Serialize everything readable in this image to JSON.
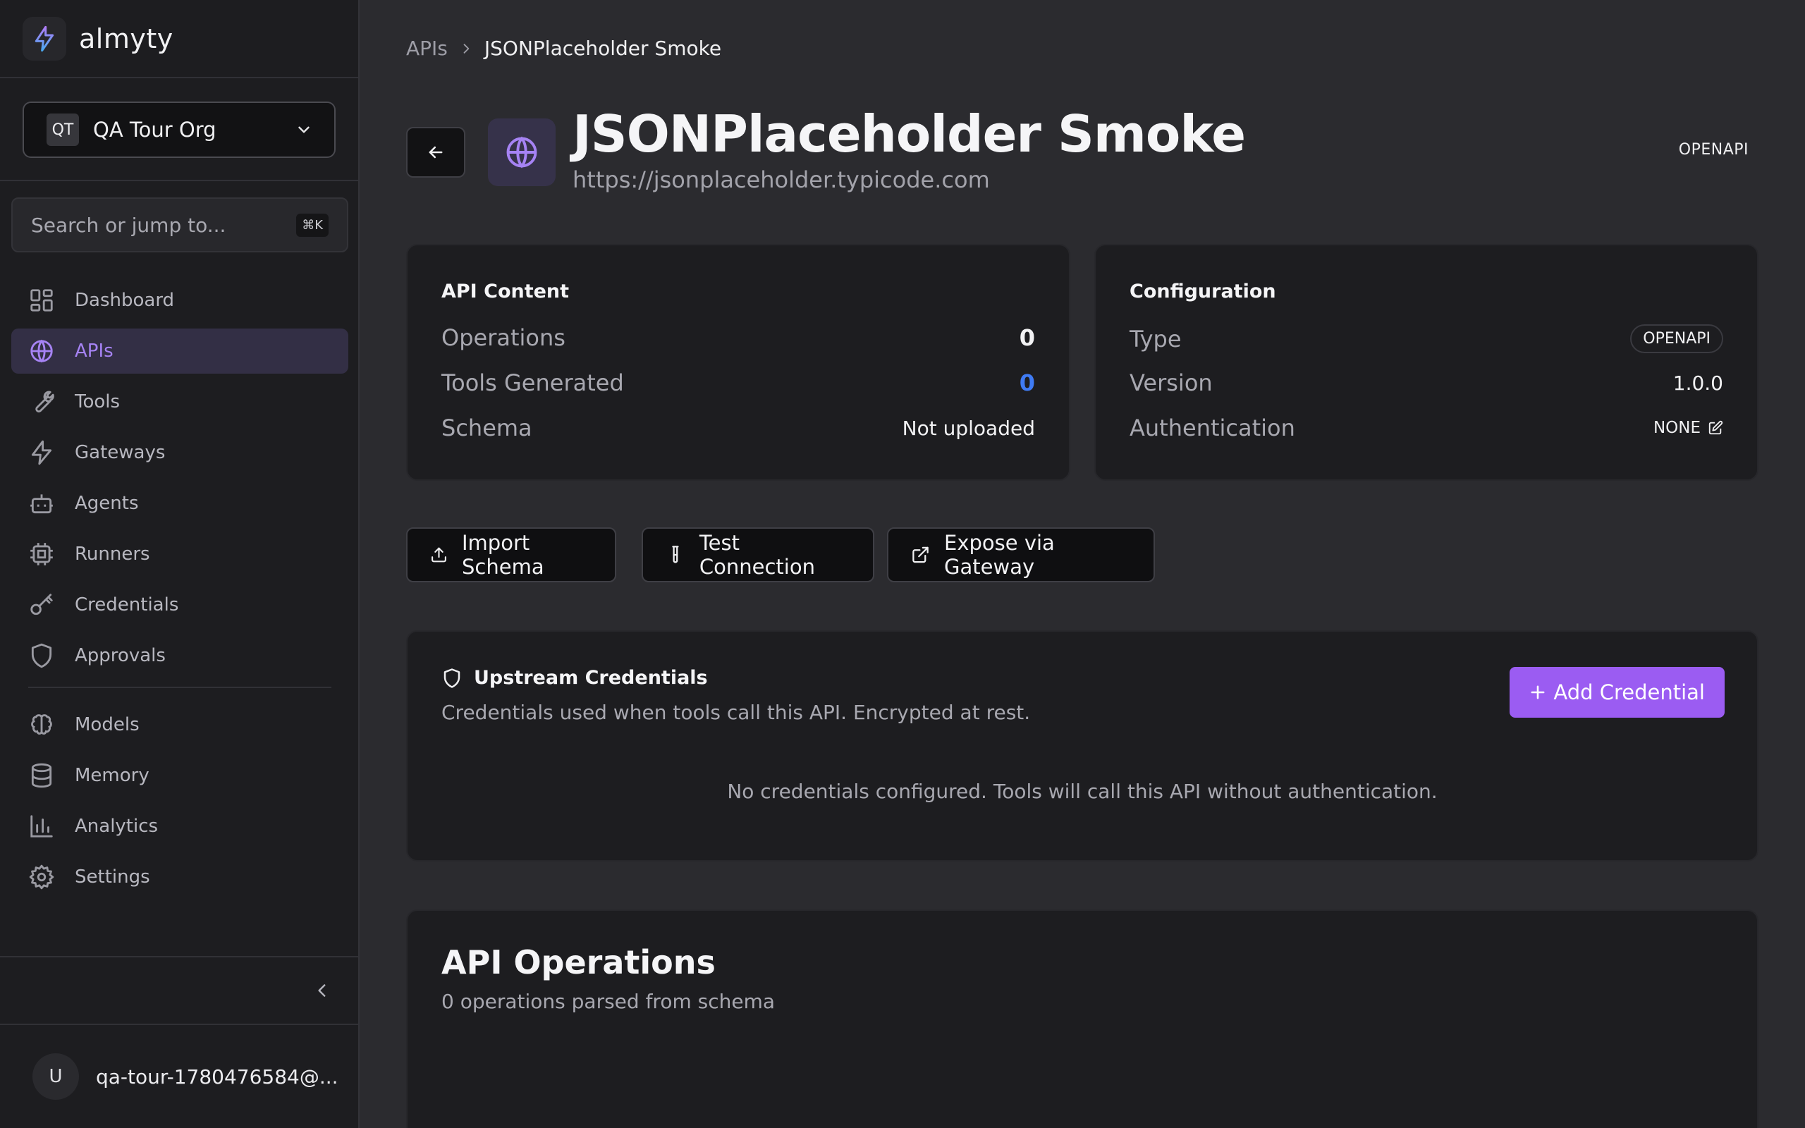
{
  "brand": {
    "name": "almyty"
  },
  "org": {
    "initials": "QT",
    "name": "QA Tour Org"
  },
  "search": {
    "placeholder": "Search or jump to...",
    "shortcut": "⌘K"
  },
  "nav": {
    "items": [
      {
        "label": "Dashboard",
        "icon": "dashboard-icon"
      },
      {
        "label": "APIs",
        "icon": "globe-icon",
        "active": true
      },
      {
        "label": "Tools",
        "icon": "wrench-icon"
      },
      {
        "label": "Gateways",
        "icon": "lightning-icon"
      },
      {
        "label": "Agents",
        "icon": "robot-icon"
      },
      {
        "label": "Runners",
        "icon": "cpu-icon"
      },
      {
        "label": "Credentials",
        "icon": "key-icon"
      },
      {
        "label": "Approvals",
        "icon": "shield-icon"
      },
      {
        "label": "Models",
        "icon": "brain-icon"
      },
      {
        "label": "Memory",
        "icon": "database-icon"
      },
      {
        "label": "Analytics",
        "icon": "bar-chart-icon"
      },
      {
        "label": "Settings",
        "icon": "gear-icon"
      }
    ]
  },
  "user": {
    "initial": "U",
    "email": "qa-tour-1780476584@..."
  },
  "breadcrumb": {
    "root": "APIs",
    "current": "JSONPlaceholder Smoke"
  },
  "header": {
    "title": "JSONPlaceholder Smoke",
    "url": "https://jsonplaceholder.typicode.com",
    "type_badge": "OPENAPI"
  },
  "api_content": {
    "title": "API Content",
    "operations_label": "Operations",
    "operations_value": "0",
    "tools_label": "Tools Generated",
    "tools_value": "0",
    "schema_label": "Schema",
    "schema_value": "Not uploaded"
  },
  "configuration": {
    "title": "Configuration",
    "type_label": "Type",
    "type_value": "OPENAPI",
    "version_label": "Version",
    "version_value": "1.0.0",
    "auth_label": "Authentication",
    "auth_value": "NONE"
  },
  "actions": {
    "import_label": "Import Schema",
    "test_label": "Test Connection",
    "expose_label": "Expose via Gateway"
  },
  "credentials": {
    "title": "Upstream Credentials",
    "subtitle": "Credentials used when tools call this API. Encrypted at rest.",
    "add_label": "Add Credential",
    "empty": "No credentials configured. Tools will call this API without authentication."
  },
  "operations": {
    "title": "API Operations",
    "subtitle": "0 operations parsed from schema"
  },
  "colors": {
    "accent": "#9b5cf2",
    "active_text": "#a683f4",
    "link_blue": "#3f7bf4"
  }
}
